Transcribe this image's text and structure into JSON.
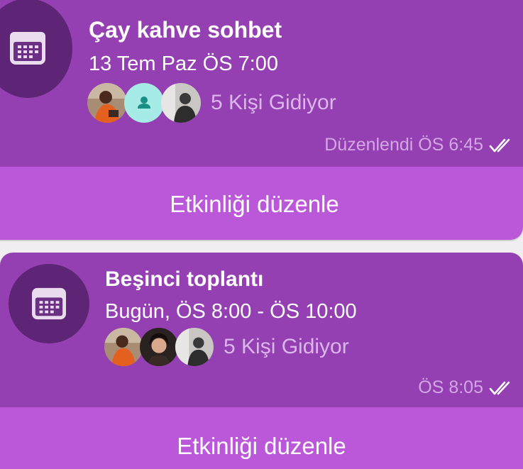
{
  "colors": {
    "bubble": "#9440b2",
    "edit_bar": "#bb57d9",
    "icon_circle": "#5e2475",
    "secondary_text": "#dab6ea"
  },
  "events": [
    {
      "title": "Çay kahve sohbet",
      "time": "13 Tem Paz ÖS 7:00",
      "attendees_text": "5 Kişi Gidiyor",
      "avatars": [
        "photo-avatar",
        "default-person-avatar",
        "photo-avatar"
      ],
      "status": "Düzenlendi ÖS 6:45",
      "status_icon": "double-check-icon",
      "action_label": "Etkinliği düzenle"
    },
    {
      "title": "Beşinci toplantı",
      "time": "Bugün, ÖS 8:00 - ÖS 10:00",
      "attendees_text": "5 Kişi Gidiyor",
      "avatars": [
        "photo-avatar",
        "photo-avatar",
        "photo-avatar"
      ],
      "status": "ÖS 8:05",
      "status_icon": "double-check-icon",
      "action_label": "Etkinliği düzenle"
    }
  ]
}
